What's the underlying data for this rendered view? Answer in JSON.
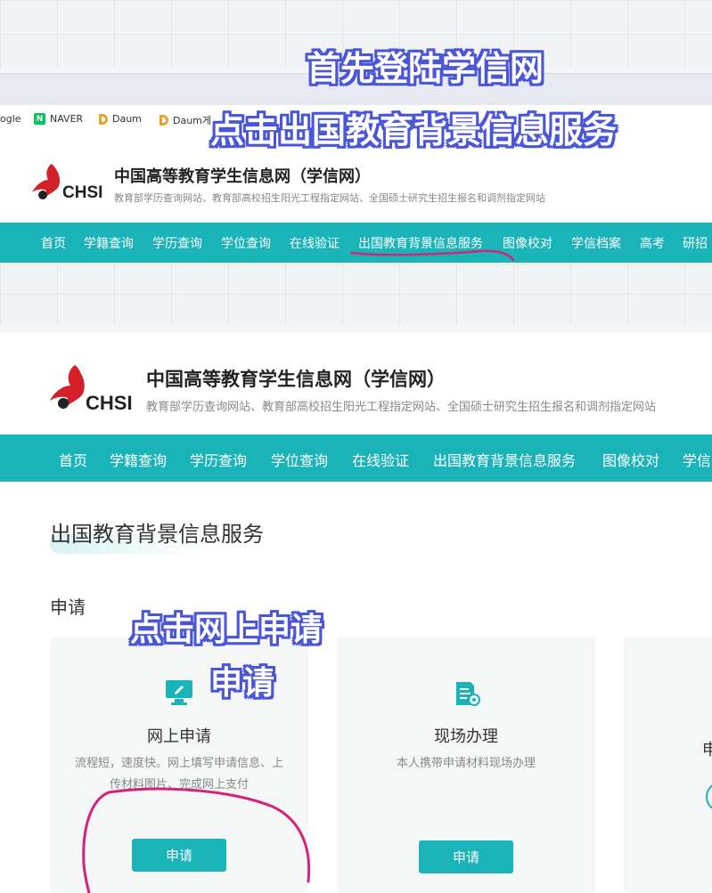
{
  "overlay": {
    "line1": "首先登陆学信网",
    "line2": "点击出国教育背景信息服务",
    "line3": "点击网上申请",
    "line4": "申请"
  },
  "bookmarks": [
    "ogle",
    "NAVER",
    "Daum",
    "Daum게"
  ],
  "site": {
    "logo_text": "CHSI",
    "title": "中国高等教育学生信息网（学信网）",
    "subtitle": "教育部学历查询网站、教育部高校招生阳光工程指定网站、全国硕士研究生招生报名和调剂指定网站"
  },
  "nav1": [
    "首页",
    "学籍查询",
    "学历查询",
    "学位查询",
    "在线验证",
    "出国教育背景信息服务",
    "图像校对",
    "学信档案",
    "高考",
    "研招"
  ],
  "nav2": [
    "首页",
    "学籍查询",
    "学历查询",
    "学位查询",
    "在线验证",
    "出国教育背景信息服务",
    "图像校对",
    "学信"
  ],
  "page": {
    "title": "出国教育背景信息服务",
    "section": "申请"
  },
  "cards": [
    {
      "title": "网上申请",
      "desc": "流程短，速度快。网上填写申请信息、上传材料图片、完成网上支付",
      "button": "申请"
    },
    {
      "title": "现场办理",
      "desc": "本人携带申请材料现场办理",
      "button": "申请"
    },
    {
      "title": "申"
    }
  ],
  "colors": {
    "accent": "#1ab4b8",
    "overlay_outline": "#4a56d8",
    "annotation": "#d4237a"
  }
}
